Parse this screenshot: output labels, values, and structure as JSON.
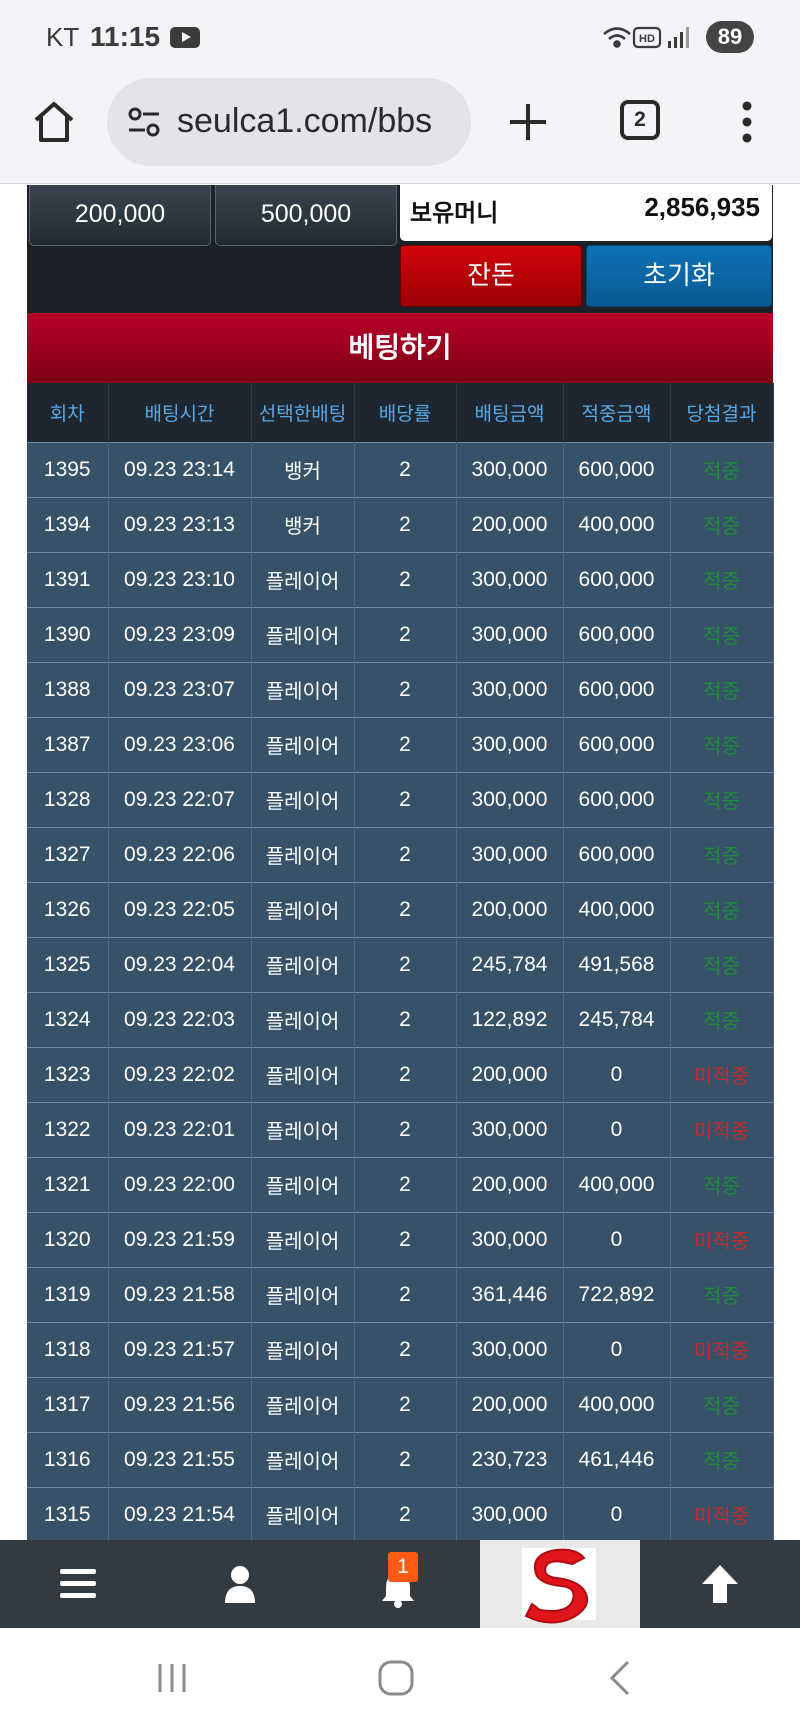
{
  "status_bar": {
    "carrier": "KT",
    "time": "11:15",
    "battery": "89"
  },
  "browser": {
    "url": "seulca1.com/bbs",
    "tab_count": "2"
  },
  "panel": {
    "chips": [
      "200,000",
      "500,000"
    ],
    "balance_label": "보유머니",
    "balance_value": "2,856,935",
    "allin_button": "잔돈",
    "reset_button": "초기화"
  },
  "bet_title": "베팅하기",
  "table": {
    "headers": [
      "회차",
      "배팅시간",
      "선택한배팅",
      "배당률",
      "배팅금액",
      "적중금액",
      "당첨결과"
    ],
    "rows": [
      [
        "1395",
        "09.23 23:14",
        "뱅커",
        "2",
        "300,000",
        "600,000",
        "적중"
      ],
      [
        "1394",
        "09.23 23:13",
        "뱅커",
        "2",
        "200,000",
        "400,000",
        "적중"
      ],
      [
        "1391",
        "09.23 23:10",
        "플레이어",
        "2",
        "300,000",
        "600,000",
        "적중"
      ],
      [
        "1390",
        "09.23 23:09",
        "플레이어",
        "2",
        "300,000",
        "600,000",
        "적중"
      ],
      [
        "1388",
        "09.23 23:07",
        "플레이어",
        "2",
        "300,000",
        "600,000",
        "적중"
      ],
      [
        "1387",
        "09.23 23:06",
        "플레이어",
        "2",
        "300,000",
        "600,000",
        "적중"
      ],
      [
        "1328",
        "09.23 22:07",
        "플레이어",
        "2",
        "300,000",
        "600,000",
        "적중"
      ],
      [
        "1327",
        "09.23 22:06",
        "플레이어",
        "2",
        "300,000",
        "600,000",
        "적중"
      ],
      [
        "1326",
        "09.23 22:05",
        "플레이어",
        "2",
        "200,000",
        "400,000",
        "적중"
      ],
      [
        "1325",
        "09.23 22:04",
        "플레이어",
        "2",
        "245,784",
        "491,568",
        "적중"
      ],
      [
        "1324",
        "09.23 22:03",
        "플레이어",
        "2",
        "122,892",
        "245,784",
        "적중"
      ],
      [
        "1323",
        "09.23 22:02",
        "플레이어",
        "2",
        "200,000",
        "0",
        "미적중"
      ],
      [
        "1322",
        "09.23 22:01",
        "플레이어",
        "2",
        "300,000",
        "0",
        "미적중"
      ],
      [
        "1321",
        "09.23 22:00",
        "플레이어",
        "2",
        "200,000",
        "400,000",
        "적중"
      ],
      [
        "1320",
        "09.23 21:59",
        "플레이어",
        "2",
        "300,000",
        "0",
        "미적중"
      ],
      [
        "1319",
        "09.23 21:58",
        "플레이어",
        "2",
        "361,446",
        "722,892",
        "적중"
      ],
      [
        "1318",
        "09.23 21:57",
        "플레이어",
        "2",
        "300,000",
        "0",
        "미적중"
      ],
      [
        "1317",
        "09.23 21:56",
        "플레이어",
        "2",
        "200,000",
        "400,000",
        "적중"
      ],
      [
        "1316",
        "09.23 21:55",
        "플레이어",
        "2",
        "230,723",
        "461,446",
        "적중"
      ],
      [
        "1315",
        "09.23 21:54",
        "플레이어",
        "2",
        "300,000",
        "0",
        "미적중"
      ]
    ]
  },
  "bottom_nav": {
    "notification_count": "1",
    "items": [
      "menu-icon",
      "user-icon",
      "bell-icon",
      "site-logo",
      "arrow-up-icon"
    ]
  },
  "colors": {
    "win": "#1f8a3a",
    "lose": "#c42a2a",
    "header_text": "#59a9e6",
    "row_bg": "#365168"
  }
}
